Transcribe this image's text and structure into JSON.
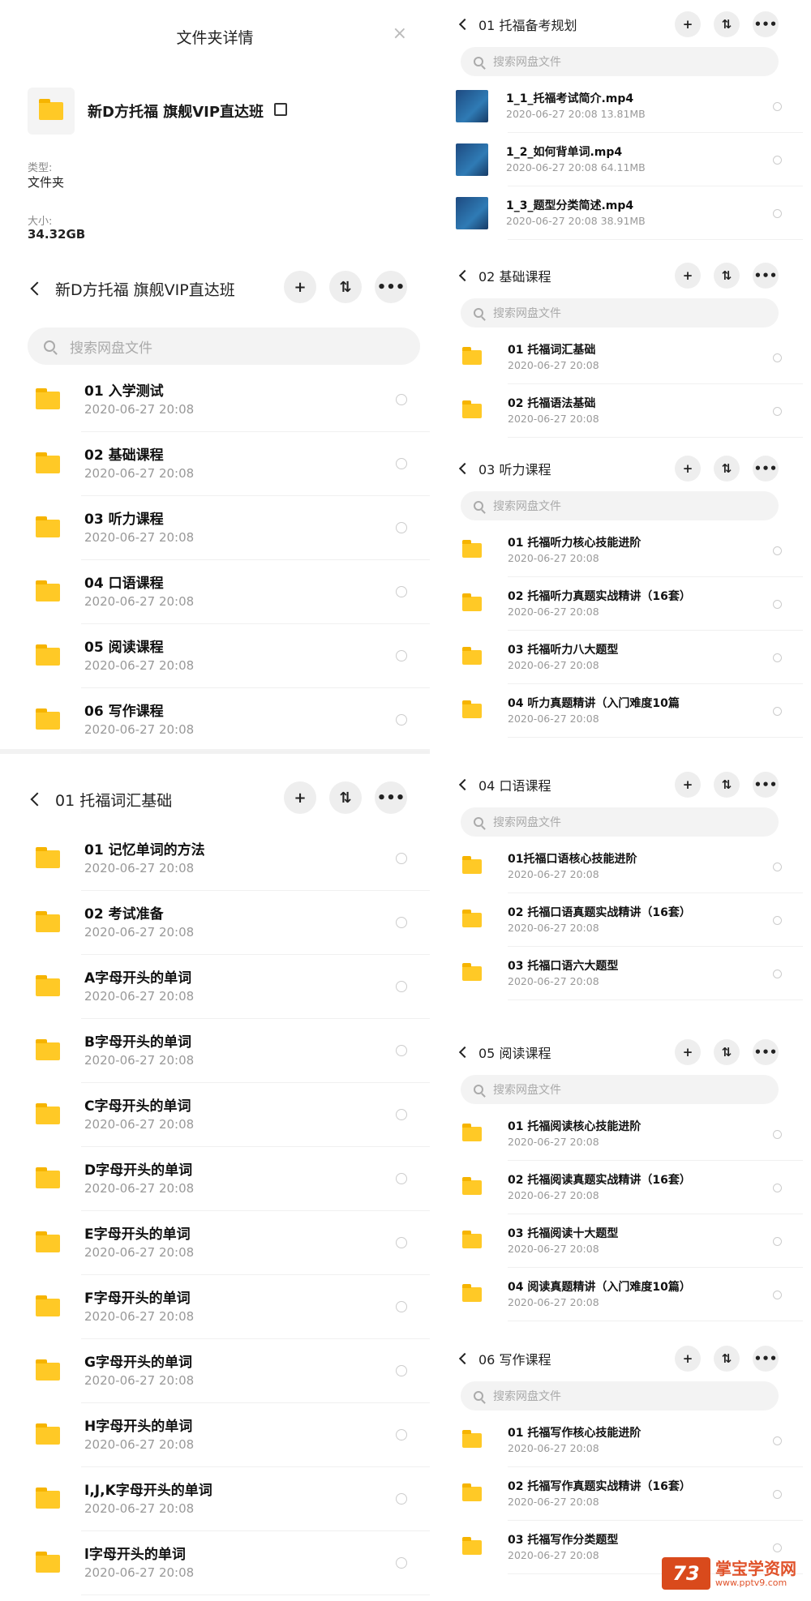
{
  "details": {
    "title": "文件夹详情",
    "close": "×",
    "name": "新D方托福 旗舰VIP直达班",
    "type_label": "类型:",
    "type_value": "文件夹",
    "size_label": "大小:",
    "size_value": "34.32GB"
  },
  "buttons": {
    "add": "+",
    "sort": "⇅",
    "more": "•••"
  },
  "search_placeholder": "搜索网盘文件",
  "main_panel": {
    "title": "新D方托福 旗舰VIP直达班",
    "items": [
      {
        "name": "01 入学测试",
        "date": "2020-06-27  20:08"
      },
      {
        "name": "02 基础课程",
        "date": "2020-06-27  20:08"
      },
      {
        "name": "03 听力课程",
        "date": "2020-06-27  20:08"
      },
      {
        "name": "04 口语课程",
        "date": "2020-06-27  20:08"
      },
      {
        "name": "05 阅读课程",
        "date": "2020-06-27  20:08"
      },
      {
        "name": "06 写作课程",
        "date": "2020-06-27  20:08"
      }
    ]
  },
  "vocab_panel": {
    "title": "01 托福词汇基础",
    "items": [
      {
        "name": "01 记忆单词的方法",
        "date": "2020-06-27  20:08"
      },
      {
        "name": "02 考试准备",
        "date": "2020-06-27  20:08"
      },
      {
        "name": "A字母开头的单词",
        "date": "2020-06-27  20:08"
      },
      {
        "name": "B字母开头的单词",
        "date": "2020-06-27  20:08"
      },
      {
        "name": "C字母开头的单词",
        "date": "2020-06-27  20:08"
      },
      {
        "name": "D字母开头的单词",
        "date": "2020-06-27  20:08"
      },
      {
        "name": "E字母开头的单词",
        "date": "2020-06-27  20:08"
      },
      {
        "name": "F字母开头的单词",
        "date": "2020-06-27  20:08"
      },
      {
        "name": "G字母开头的单词",
        "date": "2020-06-27  20:08"
      },
      {
        "name": "H字母开头的单词",
        "date": "2020-06-27  20:08"
      },
      {
        "name": "I,J,K字母开头的单词",
        "date": "2020-06-27  20:08"
      },
      {
        "name": "l字母开头的单词",
        "date": "2020-06-27  20:08"
      }
    ]
  },
  "right_panels": [
    {
      "title": "01 托福备考规划",
      "items": [
        {
          "name": "1_1_托福考试简介.mp4",
          "date": "2020-06-27  20:08    13.81MB",
          "video": true
        },
        {
          "name": "1_2_如何背单词.mp4",
          "date": "2020-06-27  20:08    64.11MB",
          "video": true
        },
        {
          "name": "1_3_题型分类简述.mp4",
          "date": "2020-06-27  20:08    38.91MB",
          "video": true
        }
      ]
    },
    {
      "title": "02 基础课程",
      "items": [
        {
          "name": "01 托福词汇基础",
          "date": "2020-06-27  20:08"
        },
        {
          "name": "02 托福语法基础",
          "date": "2020-06-27  20:08"
        }
      ]
    },
    {
      "title": "03 听力课程",
      "items": [
        {
          "name": "01 托福听力核心技能进阶",
          "date": "2020-06-27  20:08"
        },
        {
          "name": "02 托福听力真题实战精讲（16套）",
          "date": "2020-06-27  20:08"
        },
        {
          "name": "03 托福听力八大题型",
          "date": "2020-06-27  20:08"
        },
        {
          "name": "04 听力真题精讲（入门难度10篇",
          "date": "2020-06-27  20:08"
        }
      ]
    },
    {
      "title": "04 口语课程",
      "items": [
        {
          "name": "01托福口语核心技能进阶",
          "date": "2020-06-27  20:08"
        },
        {
          "name": "02 托福口语真题实战精讲（16套）",
          "date": "2020-06-27  20:08"
        },
        {
          "name": "03 托福口语六大题型",
          "date": "2020-06-27  20:08"
        }
      ]
    },
    {
      "title": "05 阅读课程",
      "items": [
        {
          "name": "01 托福阅读核心技能进阶",
          "date": "2020-06-27  20:08"
        },
        {
          "name": "02 托福阅读真题实战精讲（16套）",
          "date": "2020-06-27  20:08"
        },
        {
          "name": "03 托福阅读十大题型",
          "date": "2020-06-27  20:08"
        },
        {
          "name": "04 阅读真题精讲（入门难度10篇）",
          "date": "2020-06-27  20:08"
        }
      ]
    },
    {
      "title": "06 写作课程",
      "items": [
        {
          "name": "01 托福写作核心技能进阶",
          "date": "2020-06-27  20:08"
        },
        {
          "name": "02 托福写作真题实战精讲（16套）",
          "date": "2020-06-27  20:08"
        },
        {
          "name": "03 托福写作分类题型",
          "date": "2020-06-27  20:08"
        }
      ]
    }
  ],
  "watermark": {
    "logo": "73",
    "name": "掌宝学资网",
    "url": "www.pptv9.com"
  },
  "colors": {
    "folder": "#ffc926",
    "folder_tab": "#f6b400",
    "watermark": "#e0522a"
  }
}
